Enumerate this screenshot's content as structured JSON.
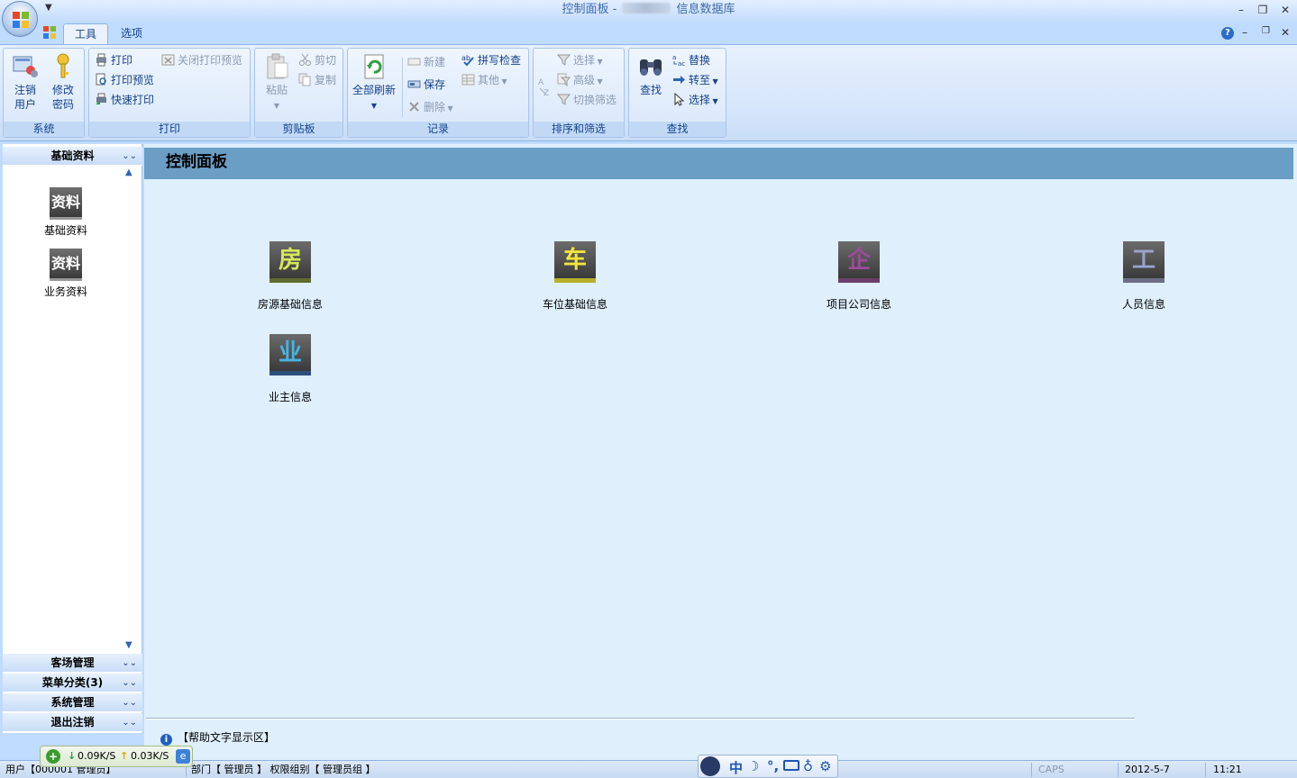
{
  "window": {
    "title_left": "控制面板 -",
    "title_right": "信息数据库",
    "minimize_glyph": "–",
    "restore_glyph": "❐",
    "close_glyph": "✕",
    "help_glyph": "?"
  },
  "tabs": [
    {
      "label": "工具",
      "active": true
    },
    {
      "label": "选项",
      "active": false
    }
  ],
  "ribbon": {
    "system": {
      "label": "系统",
      "logout": "注销\n用户",
      "logout_l1": "注销",
      "logout_l2": "用户",
      "pwd_l1": "修改",
      "pwd_l2": "密码"
    },
    "print": {
      "label": "打印",
      "print": "打印",
      "preview": "打印预览",
      "quick": "快速打印",
      "close_preview": "关闭打印预览"
    },
    "clipboard": {
      "label": "剪贴板",
      "paste": "粘贴",
      "cut": "剪切",
      "copy": "复制"
    },
    "records": {
      "label": "记录",
      "refresh_all": "全部刷新",
      "new": "新建",
      "save": "保存",
      "delete": "删除",
      "spell": "拼写检查",
      "other": "其他"
    },
    "sort": {
      "label": "排序和筛选",
      "select": "选择",
      "advanced": "高级",
      "toggle": "切换筛选"
    },
    "find": {
      "label": "查找",
      "find": "查找",
      "replace": "替换",
      "goto": "转至",
      "select": "选择"
    }
  },
  "sidebar": {
    "top_section": "基础资料",
    "items": [
      {
        "icon_text": "资料",
        "label": "基础资料"
      },
      {
        "icon_text": "资料",
        "label": "业务资料"
      }
    ],
    "bottom_sections": [
      "客场管理",
      "菜单分类(3)",
      "系统管理",
      "退出注销"
    ]
  },
  "main": {
    "title": "控制面板",
    "tiles": [
      {
        "glyph": "房",
        "label": "房源基础信息",
        "color": "#d6e85a",
        "bar": "#5f6b2f"
      },
      {
        "glyph": "车",
        "label": "车位基础信息",
        "color": "#f2e53a",
        "bar": "#b8b02a"
      },
      {
        "glyph": "企",
        "label": "项目公司信息",
        "color": "#9b4c9a",
        "bar": "#6b3f6a"
      },
      {
        "glyph": "工",
        "label": "人员信息",
        "color": "#9aa3cc",
        "bar": "#6d6f86"
      },
      {
        "glyph": "业",
        "label": "业主信息",
        "color": "#48b3e0",
        "bar": "#2d4f7a"
      }
    ],
    "help_text": "【帮助文字显示区】"
  },
  "statusbar": {
    "user": "用户【000001 管理员】",
    "dept": "部门【 管理员 】 权限组别【 管理员组 】",
    "caps": "CAPS",
    "date": "2012-5-7",
    "time": "11:21"
  },
  "net": {
    "down": "0.09K/S",
    "up": "0.03K/S"
  },
  "ime": {
    "mode": "中"
  }
}
